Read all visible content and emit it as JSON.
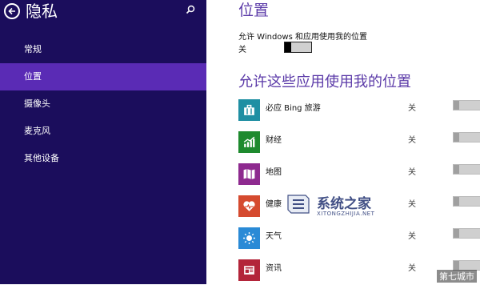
{
  "sidebar": {
    "title": "隐私",
    "items": [
      {
        "label": "常规",
        "active": false
      },
      {
        "label": "位置",
        "active": true
      },
      {
        "label": "摄像头",
        "active": false
      },
      {
        "label": "麦克风",
        "active": false
      },
      {
        "label": "其他设备",
        "active": false
      }
    ],
    "colors": {
      "bg": "#1b0d5c",
      "active": "#5a2bb5"
    }
  },
  "main": {
    "title": "位置",
    "allow_label": "允许 Windows 和应用使用我的位置",
    "allow_state": "关",
    "apps_title": "允许这些应用使用我的位置",
    "apps": [
      {
        "name": "必应 Bing 旅游",
        "state": "关",
        "icon": "suitcase-icon",
        "color": "#1f8fa3"
      },
      {
        "name": "财经",
        "state": "关",
        "icon": "chart-icon",
        "color": "#1e8a2e"
      },
      {
        "name": "地图",
        "state": "关",
        "icon": "map-icon",
        "color": "#8e2a8f"
      },
      {
        "name": "健康",
        "state": "关",
        "icon": "heart-icon",
        "color": "#d54a2f"
      },
      {
        "name": "天气",
        "state": "关",
        "icon": "sun-icon",
        "color": "#2a8ad6"
      },
      {
        "name": "资讯",
        "state": "关",
        "icon": "news-icon",
        "color": "#b3253a"
      }
    ]
  },
  "watermark": {
    "brand": "系统之家",
    "url": "XITONGZHIJIA.NET",
    "corner": "第七城市"
  }
}
